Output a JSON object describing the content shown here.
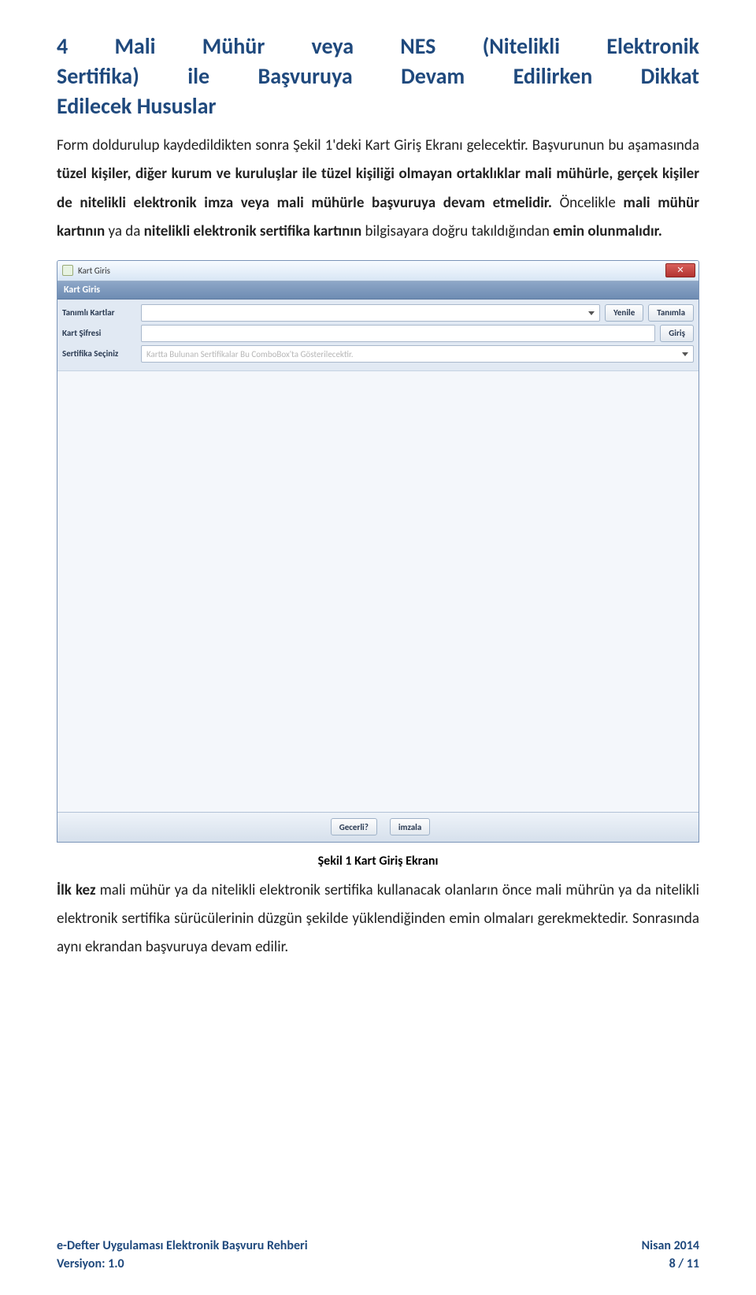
{
  "heading": {
    "line1_words": [
      "4",
      "Mali",
      "Mühür",
      "veya",
      "NES",
      "(Nitelikli",
      "Elektronik"
    ],
    "line2_words": [
      "Sertifika)",
      "ile",
      "Başvuruya",
      "Devam",
      "Edilirken",
      "Dikkat"
    ],
    "line3": "Edilecek Hususlar"
  },
  "para1": "Form doldurulup kaydedildikten sonra Şekil 1'deki Kart Giriş Ekranı gelecektir. Başvurunun bu aşamasında ",
  "para1_bold": "tüzel kişiler, diğer kurum ve kuruluşlar ile tüzel kişiliği olmayan ortaklıklar mali mühürle, gerçek kişiler de nitelikli elektronik imza veya mali mühürle başvuruya devam etmelidir.",
  "para1_tail1": " Öncelikle ",
  "para1_bold2": "mali mühür kartının",
  "para1_tail2": " ya da ",
  "para1_bold3": "nitelikli elektronik sertifika kartının",
  "para1_tail3": " bilgisayara doğru takıldığından ",
  "para1_bold4": "emin olunmalıdır.",
  "window": {
    "title": "Kart Giris",
    "close_glyph": "✕",
    "panel_title": "Kart Giris",
    "rows": {
      "r1_label": "Tanımlı Kartlar",
      "r2_label": "Kart Şifresi",
      "r3_label": "Sertifika Seçiniz",
      "r3_placeholder": "Kartta Bulunan Sertifikalar Bu ComboBox'ta Gösterilecektir."
    },
    "buttons": {
      "yenile": "Yenile",
      "tanimla": "Tanımla",
      "giris": "Giriş",
      "gecerli": "Gecerli?",
      "imzala": "imzala"
    }
  },
  "caption": "Şekil 1 Kart Giriş Ekranı",
  "para2_lead_bold": "İlk kez",
  "para2_body": " mali mühür ya da nitelikli elektronik sertifika kullanacak olanların önce mali mührün ya da nitelikli elektronik sertifika sürücülerinin düzgün şekilde yüklendiğinden emin olmaları gerekmektedir. Sonrasında aynı ekrandan başvuruya devam edilir.",
  "footer": {
    "left_line1": "e-Defter Uygulaması Elektronik Başvuru Rehberi",
    "left_line2": "Versiyon: 1.0",
    "right_line1": "Nisan 2014",
    "right_line2": "8 / 11"
  }
}
